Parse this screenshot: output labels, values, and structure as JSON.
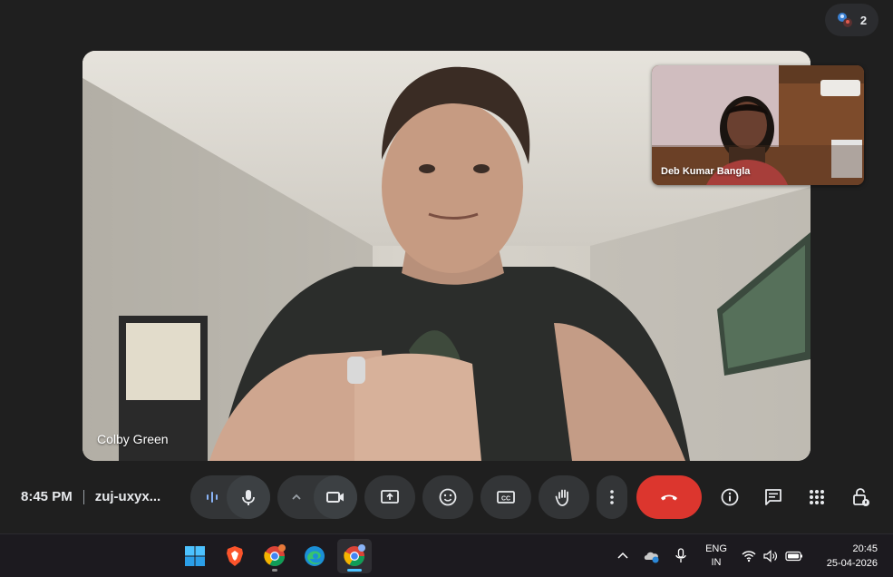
{
  "participants": {
    "count": "2",
    "icon": "people-icon"
  },
  "main_tile": {
    "name": "Colby Green"
  },
  "self_tile": {
    "name": "Deb Kumar Bangla"
  },
  "controls": {
    "time": "8:45 PM",
    "meeting_code": "zuj-uxyx...",
    "buttons": [
      "audio-levels-icon",
      "microphone-icon",
      "chevron-up-icon",
      "camera-icon",
      "present-screen-icon",
      "emoji-icon",
      "captions-icon",
      "raise-hand-icon",
      "more-options-icon",
      "end-call-icon"
    ],
    "right_icons": [
      "info-icon",
      "chat-icon",
      "activities-icon",
      "host-controls-icon"
    ]
  },
  "taskbar": {
    "apps": [
      "windows-start-icon",
      "brave-browser-icon",
      "chrome-icon",
      "edge-icon",
      "chrome-active-icon"
    ],
    "language": {
      "line1": "ENG",
      "line2": "IN"
    },
    "time": "20:45",
    "date": "25-04-2026"
  },
  "colors": {
    "end_call": "#dc362e",
    "button_bg": "#333537",
    "accent": "#4cc2ff"
  }
}
